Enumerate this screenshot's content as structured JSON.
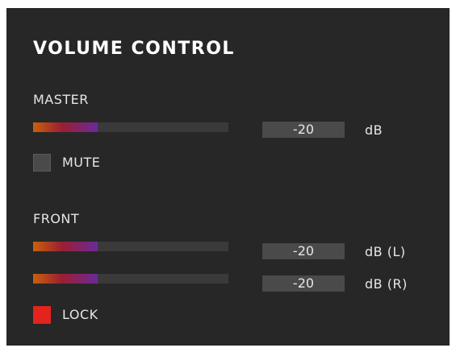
{
  "title": "VOLUME CONTROL",
  "master": {
    "label": "MASTER",
    "level_fraction": 0.33,
    "value": "-20",
    "unit": "dB",
    "mute": {
      "label": "MUTE",
      "checked": false
    }
  },
  "front": {
    "label": "FRONT",
    "left": {
      "level_fraction": 0.33,
      "value": "-20",
      "unit": "dB (L)"
    },
    "right": {
      "level_fraction": 0.33,
      "value": "-20",
      "unit": "dB (R)"
    },
    "lock": {
      "label": "LOCK",
      "checked": true
    }
  },
  "colors": {
    "panel_bg": "#272727",
    "slider_track": "#3a3a3a",
    "value_box_bg": "#4a4a4a",
    "checkbox_checked": "#e3231c",
    "checkbox_unchecked": "#4a4a4a",
    "text": "#e6e6e6",
    "gradient": [
      "#c8610a",
      "#9a1e33",
      "#6a2a9a"
    ]
  }
}
